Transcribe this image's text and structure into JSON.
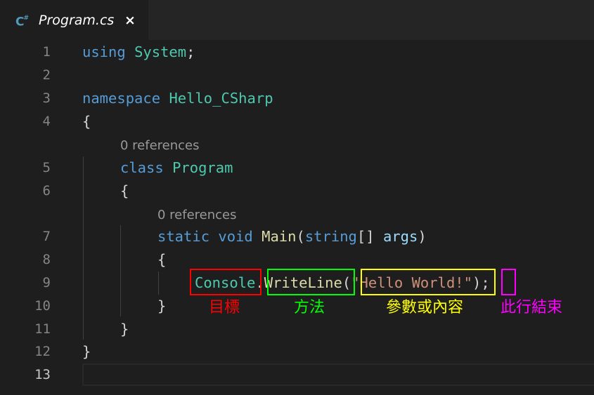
{
  "tab": {
    "icon": "C",
    "icon_sup": "#",
    "title": "Program.cs",
    "close": "×"
  },
  "lines": [
    "1",
    "2",
    "3",
    "4",
    "5",
    "6",
    "7",
    "8",
    "9",
    "10",
    "11",
    "12",
    "13"
  ],
  "code": {
    "l1_kw": "using",
    "l1_ns": "System",
    "l1_semi": ";",
    "l3_kw": "namespace",
    "l3_name": "Hello_CSharp",
    "l4": "{",
    "lens_class": "0 references",
    "l5_kw": "class",
    "l5_name": "Program",
    "l6": "{",
    "lens_main": "0 references",
    "l7_static": "static",
    "l7_void": "void",
    "l7_main": "Main",
    "l7_open": "(",
    "l7_string": "string",
    "l7_brackets": "[]",
    "l7_args": "args",
    "l7_close": ")",
    "l8": "{",
    "l9_console": "Console",
    "l9_dot": ".",
    "l9_writeline": "WriteLine",
    "l9_open": "(",
    "l9_string": "\"Hello World!\"",
    "l9_close": ")",
    "l9_semi": ";",
    "l10": "}",
    "l11": "}",
    "l12": "}"
  },
  "annotations": {
    "target": {
      "label": "目標",
      "color": "#ff0000"
    },
    "method": {
      "label": "方法",
      "color": "#00ff00"
    },
    "argument": {
      "label": "參數或內容",
      "color": "#ffff00"
    },
    "end": {
      "label": "此行結束",
      "color": "#ff00ff"
    }
  }
}
